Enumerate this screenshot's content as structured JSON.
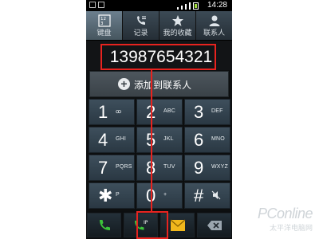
{
  "status_bar": {
    "time": "14:28"
  },
  "tabs": [
    {
      "label": "键盘",
      "icon": "dialpad-icon",
      "active": true
    },
    {
      "label": "记录",
      "icon": "call-log-icon",
      "active": false
    },
    {
      "label": "我的收藏",
      "icon": "star-icon",
      "active": false
    },
    {
      "label": "联系人",
      "icon": "contact-icon",
      "active": false
    }
  ],
  "dial_number": "13987654321",
  "add_to_contacts": {
    "label": "添加到联系人",
    "icon": "plus-icon"
  },
  "keypad": [
    {
      "digit": "1",
      "letters": "ꝏ"
    },
    {
      "digit": "2",
      "letters": "ABC"
    },
    {
      "digit": "3",
      "letters": "DEF"
    },
    {
      "digit": "4",
      "letters": "GHI"
    },
    {
      "digit": "5",
      "letters": "JKL"
    },
    {
      "digit": "6",
      "letters": "MNO"
    },
    {
      "digit": "7",
      "letters": "PQRS"
    },
    {
      "digit": "8",
      "letters": "TUV"
    },
    {
      "digit": "9",
      "letters": "WXYZ"
    },
    {
      "digit": "✱",
      "letters": "P"
    },
    {
      "digit": "0",
      "letters": "+"
    },
    {
      "digit": "#",
      "letters": ""
    }
  ],
  "actions": [
    {
      "name": "call-icon",
      "color": "#3cc43a"
    },
    {
      "name": "ip-call-icon",
      "color": "#3cc43a",
      "badge": "IP"
    },
    {
      "name": "message-icon",
      "color": "#f1b81c"
    },
    {
      "name": "backspace-icon",
      "color": "#9aa5ae"
    }
  ],
  "highlight_color": "#e8231f",
  "watermark": {
    "main": "PConline",
    "sub": "太平洋电脑网"
  }
}
